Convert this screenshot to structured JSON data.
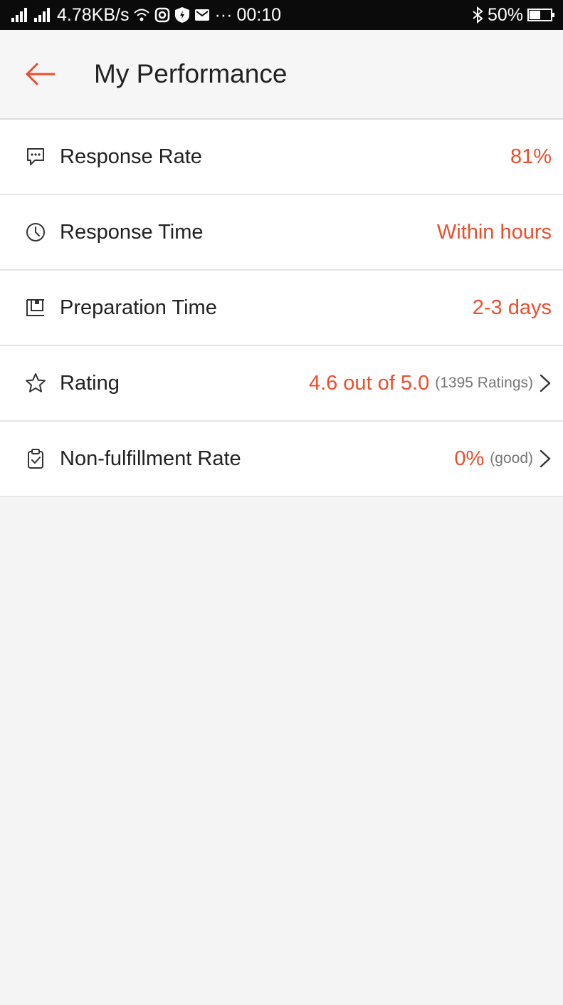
{
  "status_bar": {
    "speed": "4.78KB/s",
    "dots": "···",
    "time": "00:10",
    "battery": "50%"
  },
  "header": {
    "title": "My Performance",
    "back_icon": "arrow-left-icon"
  },
  "colors": {
    "accent": "#ee4d2d",
    "background": "#f4f4f4",
    "muted": "#777777"
  },
  "metrics": [
    {
      "label": "Response Rate",
      "value": "81%",
      "icon": "chat-bubble-icon"
    },
    {
      "label": "Response Time",
      "value": "Within hours",
      "icon": "clock-icon"
    },
    {
      "label": "Preparation Time",
      "value": "2-3 days",
      "icon": "package-icon"
    },
    {
      "label": "Rating",
      "value": "4.6 out of 5.0",
      "sub": "(1395 Ratings)",
      "icon": "star-icon"
    },
    {
      "label": "Non-fulfillment Rate",
      "value": "0%",
      "sub": "(good)",
      "icon": "clipboard-check-icon"
    }
  ]
}
